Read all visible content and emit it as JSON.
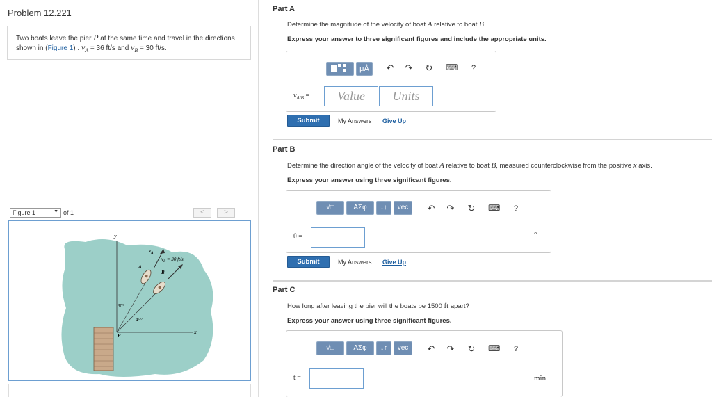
{
  "problem": {
    "title": "Problem 12.221",
    "text_part1": "Two boats leave the pier ",
    "pier_var": "P",
    "text_part2": " at the same time and travel in the directions shown in (",
    "figure_link": "Figure 1",
    "text_part3": ") . ",
    "va": "v",
    "va_sub": "A",
    "va_val": " = 36  ft/s and ",
    "vb": "v",
    "vb_sub": "B",
    "vb_val": " = 30 ft/s."
  },
  "figure_nav": {
    "select_value": "Figure 1",
    "of_text": "of 1",
    "prev": "<",
    "next": ">"
  },
  "figure": {
    "y_axis": "y",
    "x_axis": "x",
    "label_A": "A",
    "label_B": "B",
    "label_P": "P",
    "label_vA": "v",
    "label_vA_sub": "A",
    "label_vB": "v",
    "label_vB_sub": "B",
    "label_vB_val": " = 30 ft/s",
    "angle_30": "30°",
    "angle_45": "45°"
  },
  "partA": {
    "title": "Part A",
    "question_pre": "Determine the magnitude of the velocity of boat ",
    "var1": "A",
    "question_mid": " relative to boat ",
    "var2": "B",
    "instruction": "Express your answer to three significant figures and include the appropriate units.",
    "answer_label": "v",
    "answer_label_sub": "A/B",
    "answer_label_eq": " =",
    "value_placeholder": "Value",
    "units_placeholder": "Units",
    "tool_mu": "μÅ",
    "submit": "Submit",
    "my_answers": "My Answers",
    "give_up": "Give Up"
  },
  "partB": {
    "title": "Part B",
    "question_pre": "Determine the direction angle of the velocity of boat ",
    "var1": "A",
    "question_mid": " relative to boat ",
    "var2": "B",
    "question_post": ", measured counterclockwise from the positive ",
    "var3": "x",
    "question_end": " axis.",
    "instruction": "Express your answer using three significant figures.",
    "answer_label": "θ =",
    "unit": "°",
    "tool_sqrt": "√□",
    "tool_greek": "ΑΣφ",
    "tool_arrows": "↓↑",
    "tool_vec": "vec",
    "submit": "Submit",
    "my_answers": "My Answers",
    "give_up": "Give Up"
  },
  "partC": {
    "title": "Part C",
    "question_pre": "How long after leaving the pier will the boats be 1500  ",
    "unit_ft": "ft",
    "question_post": " apart?",
    "instruction": "Express your answer using three significant figures.",
    "answer_label": "t =",
    "unit": "min",
    "tool_sqrt": "√□",
    "tool_greek": "ΑΣφ",
    "tool_arrows": "↓↑",
    "tool_vec": "vec"
  },
  "toolbar_icons": {
    "undo": "↶",
    "redo": "↷",
    "reset": "↻",
    "keyboard": "⌨",
    "help": "?"
  },
  "colors": {
    "accent": "#2f6fb0",
    "toolbar_bg": "#dfe9f5",
    "tool_button": "#6f8eb3",
    "water": "#9ccfc8",
    "field_border": "#6d9fd1"
  }
}
